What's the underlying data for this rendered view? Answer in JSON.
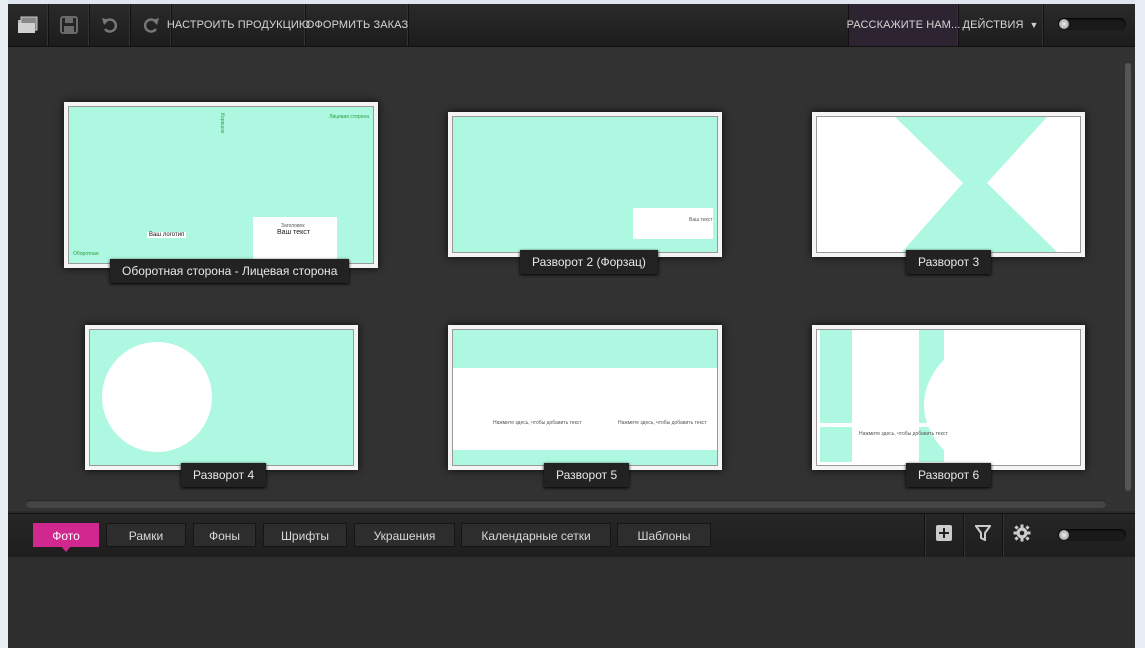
{
  "toolbar": {
    "customize_label": "НАСТРОИТЬ ПРОДУКЦИЮ",
    "order_label": "ОФОРМИТЬ ЗАКАЗ",
    "tell_label": "РАССКАЖИТЕ НАМ...",
    "actions_label": "ДЕЙСТВИЯ",
    "actions_arrow": "▼",
    "icons": [
      "open-icon",
      "save-icon",
      "undo-icon",
      "redo-icon"
    ]
  },
  "spreads": [
    {
      "label": "Оборотная сторона - Лицевая сторона",
      "texts": {
        "spine": "Корешок",
        "top_right": "Лицевая сторона",
        "bottom_left": "Оборотная",
        "small_caption": "Заголовок",
        "caption": "Ваш текст",
        "center_note": "Ваш логотип"
      }
    },
    {
      "label": "Разворот 2 (Форзац)",
      "texts": {
        "note": "Ваш текст"
      }
    },
    {
      "label": "Разворот 3"
    },
    {
      "label": "Разворот 4"
    },
    {
      "label": "Разворот 5",
      "texts": {
        "left_note": "Нажмите здесь, чтобы добавить текст",
        "right_note": "Нажмите здесь, чтобы добавить текст"
      }
    },
    {
      "label": "Разворот 6",
      "texts": {
        "note": "Нажмите здесь, чтобы добавить текст"
      }
    }
  ],
  "panel": {
    "tabs": [
      "Фото",
      "Рамки",
      "Фоны",
      "Шрифты",
      "Украшения",
      "Календарные сетки",
      "Шаблоны"
    ],
    "active_tab": "Фото",
    "icons": [
      "add-icon",
      "filter-icon",
      "settings-icon"
    ]
  },
  "colors": {
    "accent": "#d0288f",
    "canvas_mint": "#aef8e1",
    "background": "#323232"
  }
}
